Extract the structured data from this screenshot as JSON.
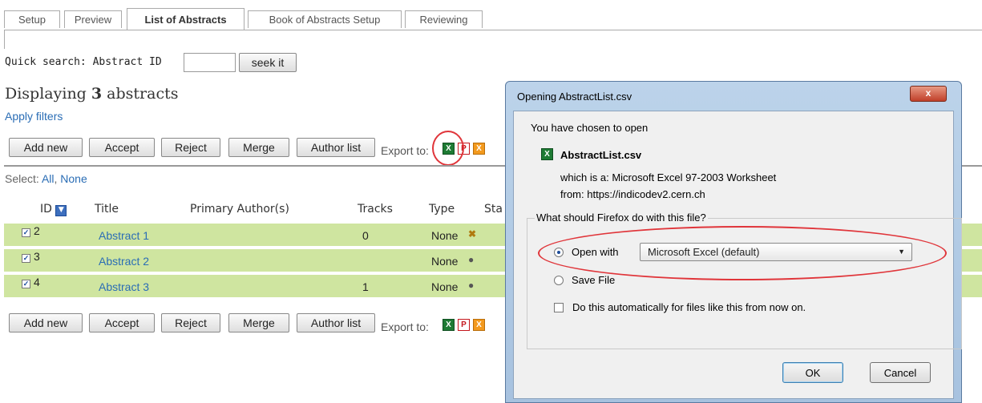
{
  "tabs": [
    {
      "label": "Setup"
    },
    {
      "label": "Preview"
    },
    {
      "label": "List of Abstracts"
    },
    {
      "label": "Book of Abstracts Setup"
    },
    {
      "label": "Reviewing"
    }
  ],
  "quick_search": {
    "label": "Quick search: Abstract ID",
    "value": "",
    "button": "seek it"
  },
  "summary": {
    "prefix": "Displaying",
    "count": "3",
    "suffix": "abstracts"
  },
  "apply_filters": "Apply filters",
  "toolbar": {
    "add_new": "Add new",
    "accept": "Accept",
    "reject": "Reject",
    "merge": "Merge",
    "author_list": "Author list",
    "export_label": "Export to:"
  },
  "select": {
    "label": "Select:",
    "all": "All",
    "sep": ",",
    "none": "None"
  },
  "columns": {
    "id": "ID",
    "title": "Title",
    "authors": "Primary Author(s)",
    "tracks": "Tracks",
    "type": "Type",
    "status": "Sta"
  },
  "rows": [
    {
      "id": "2",
      "title": "Abstract 1",
      "tracks": "0",
      "type": "None"
    },
    {
      "id": "3",
      "title": "Abstract 2",
      "tracks": "",
      "type": "None"
    },
    {
      "id": "4",
      "title": "Abstract 3",
      "tracks": "1",
      "type": "None"
    }
  ],
  "dialog": {
    "title": "Opening AbstractList.csv",
    "close": "x",
    "chosen": "You have chosen to open",
    "filename": "AbstractList.csv",
    "which_is_label": "which is a:",
    "which_is_value": "Microsoft Excel 97-2003 Worksheet",
    "from_label": "from:",
    "from_value": "https://indicodev2.cern.ch",
    "question": "What should Firefox do with this file?",
    "open_with": "Open with",
    "app": "Microsoft Excel (default)",
    "save_file": "Save File",
    "auto": "Do this automatically for files like this from now on.",
    "ok": "OK",
    "cancel": "Cancel"
  },
  "colors": {
    "row_bg": "#cfe5a0",
    "link": "#2a6db5",
    "annotation": "#e0353a"
  }
}
